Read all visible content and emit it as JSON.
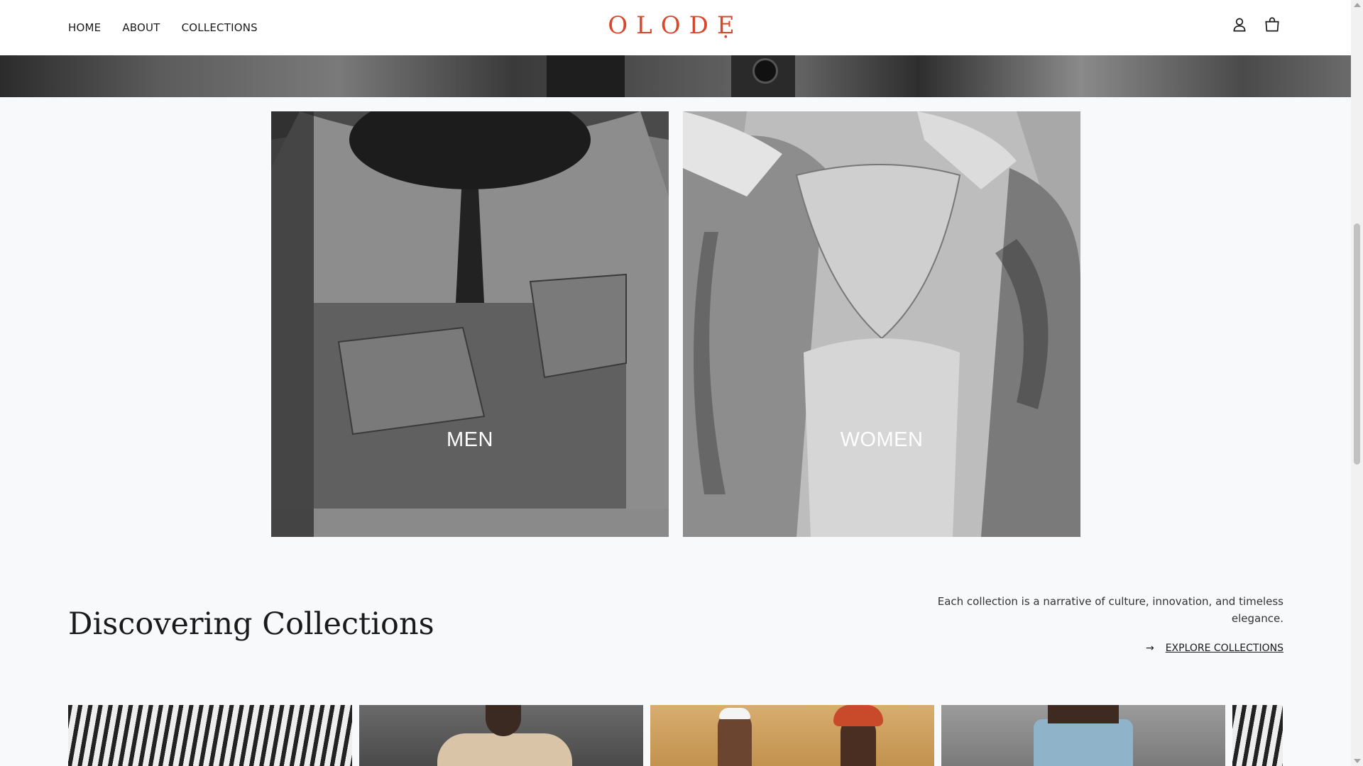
{
  "nav": {
    "items": [
      {
        "label": "HOME"
      },
      {
        "label": "ABOUT"
      },
      {
        "label": "COLLECTIONS"
      }
    ]
  },
  "brand": {
    "logo_text": "OLODẸ",
    "accent_color": "#d8472b"
  },
  "header_icons": [
    "account-icon",
    "cart-icon"
  ],
  "categories": [
    {
      "label": "MEN"
    },
    {
      "label": "WOMEN"
    }
  ],
  "collections": {
    "heading": "Discovering Collections",
    "description": "Each collection is a narrative of culture, innovation, and timeless elegance.",
    "explore_label": "EXPLORE COLLECTIONS",
    "explore_icon": "arrow-right-icon"
  }
}
